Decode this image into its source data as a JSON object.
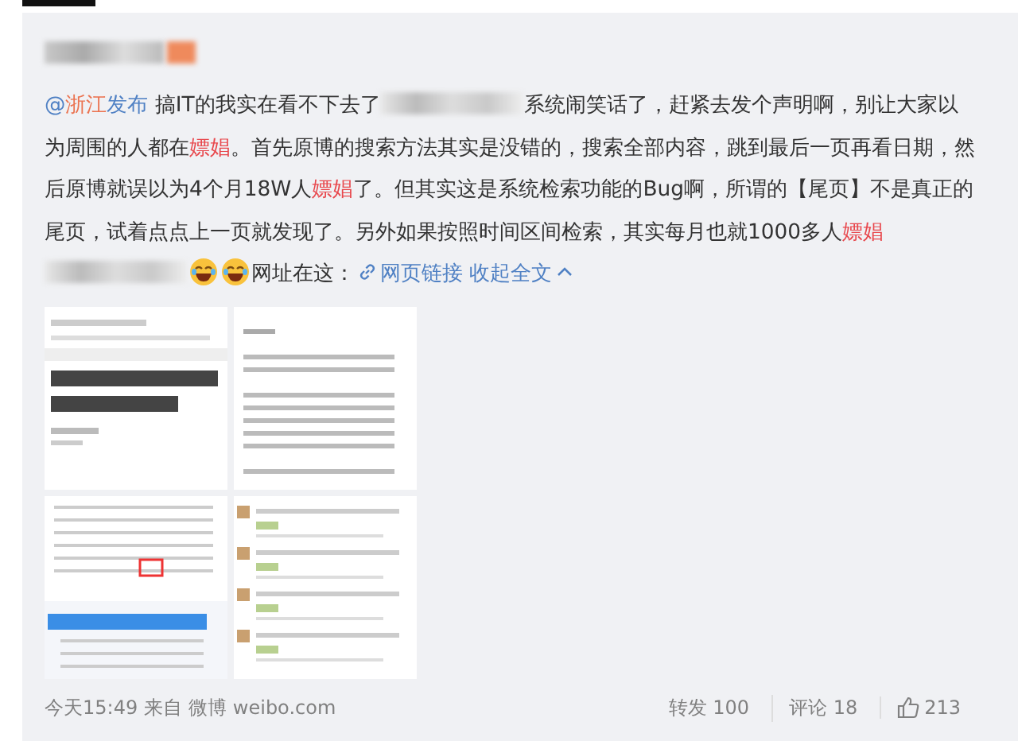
{
  "post": {
    "segments": [
      {
        "kind": "mention",
        "parts": [
          {
            "text": "@",
            "highlight": false
          },
          {
            "text": "浙江",
            "highlight": true
          },
          {
            "text": "发布",
            "highlight": false
          }
        ]
      },
      {
        "kind": "plain",
        "text": " 搞IT的我实在看不下去了"
      },
      {
        "kind": "redacted"
      },
      {
        "kind": "plain",
        "text": "系统闹笑话了，赶紧去发个声明啊，别让大家以为周围的人都在"
      },
      {
        "kind": "highlight",
        "text": "嫖娼"
      },
      {
        "kind": "plain",
        "text": "。首先原博的搜索方法其实是没错的，搜索全部内容，跳到最后一页再看日期，然后原博就误以为4个月18W人"
      },
      {
        "kind": "highlight",
        "text": "嫖娼"
      },
      {
        "kind": "plain",
        "text": "了。但其实这是系统检索功能的Bug啊，所谓的【尾页】不是真正的尾页，试着点点上一页就发现了。另外如果按照时间区间检索，其实每月也就1000多人"
      },
      {
        "kind": "highlight",
        "text": "嫖娼"
      },
      {
        "kind": "redacted"
      },
      {
        "kind": "emoji"
      },
      {
        "kind": "emoji"
      },
      {
        "kind": "plain",
        "text": "网址在这："
      },
      {
        "kind": "link",
        "text": "网页链接"
      },
      {
        "kind": "collapse",
        "text": "收起全文"
      }
    ],
    "images": [
      {
        "kind": "article"
      },
      {
        "kind": "text"
      },
      {
        "kind": "table"
      },
      {
        "kind": "comments"
      }
    ],
    "time": "今天15:49",
    "source_prefix": "来自",
    "source": "微博 weibo.com",
    "actions": [
      {
        "kind": "repost",
        "text": "转发 100"
      },
      {
        "kind": "comment",
        "text": "评论 18"
      },
      {
        "kind": "like",
        "text": "213"
      }
    ]
  }
}
